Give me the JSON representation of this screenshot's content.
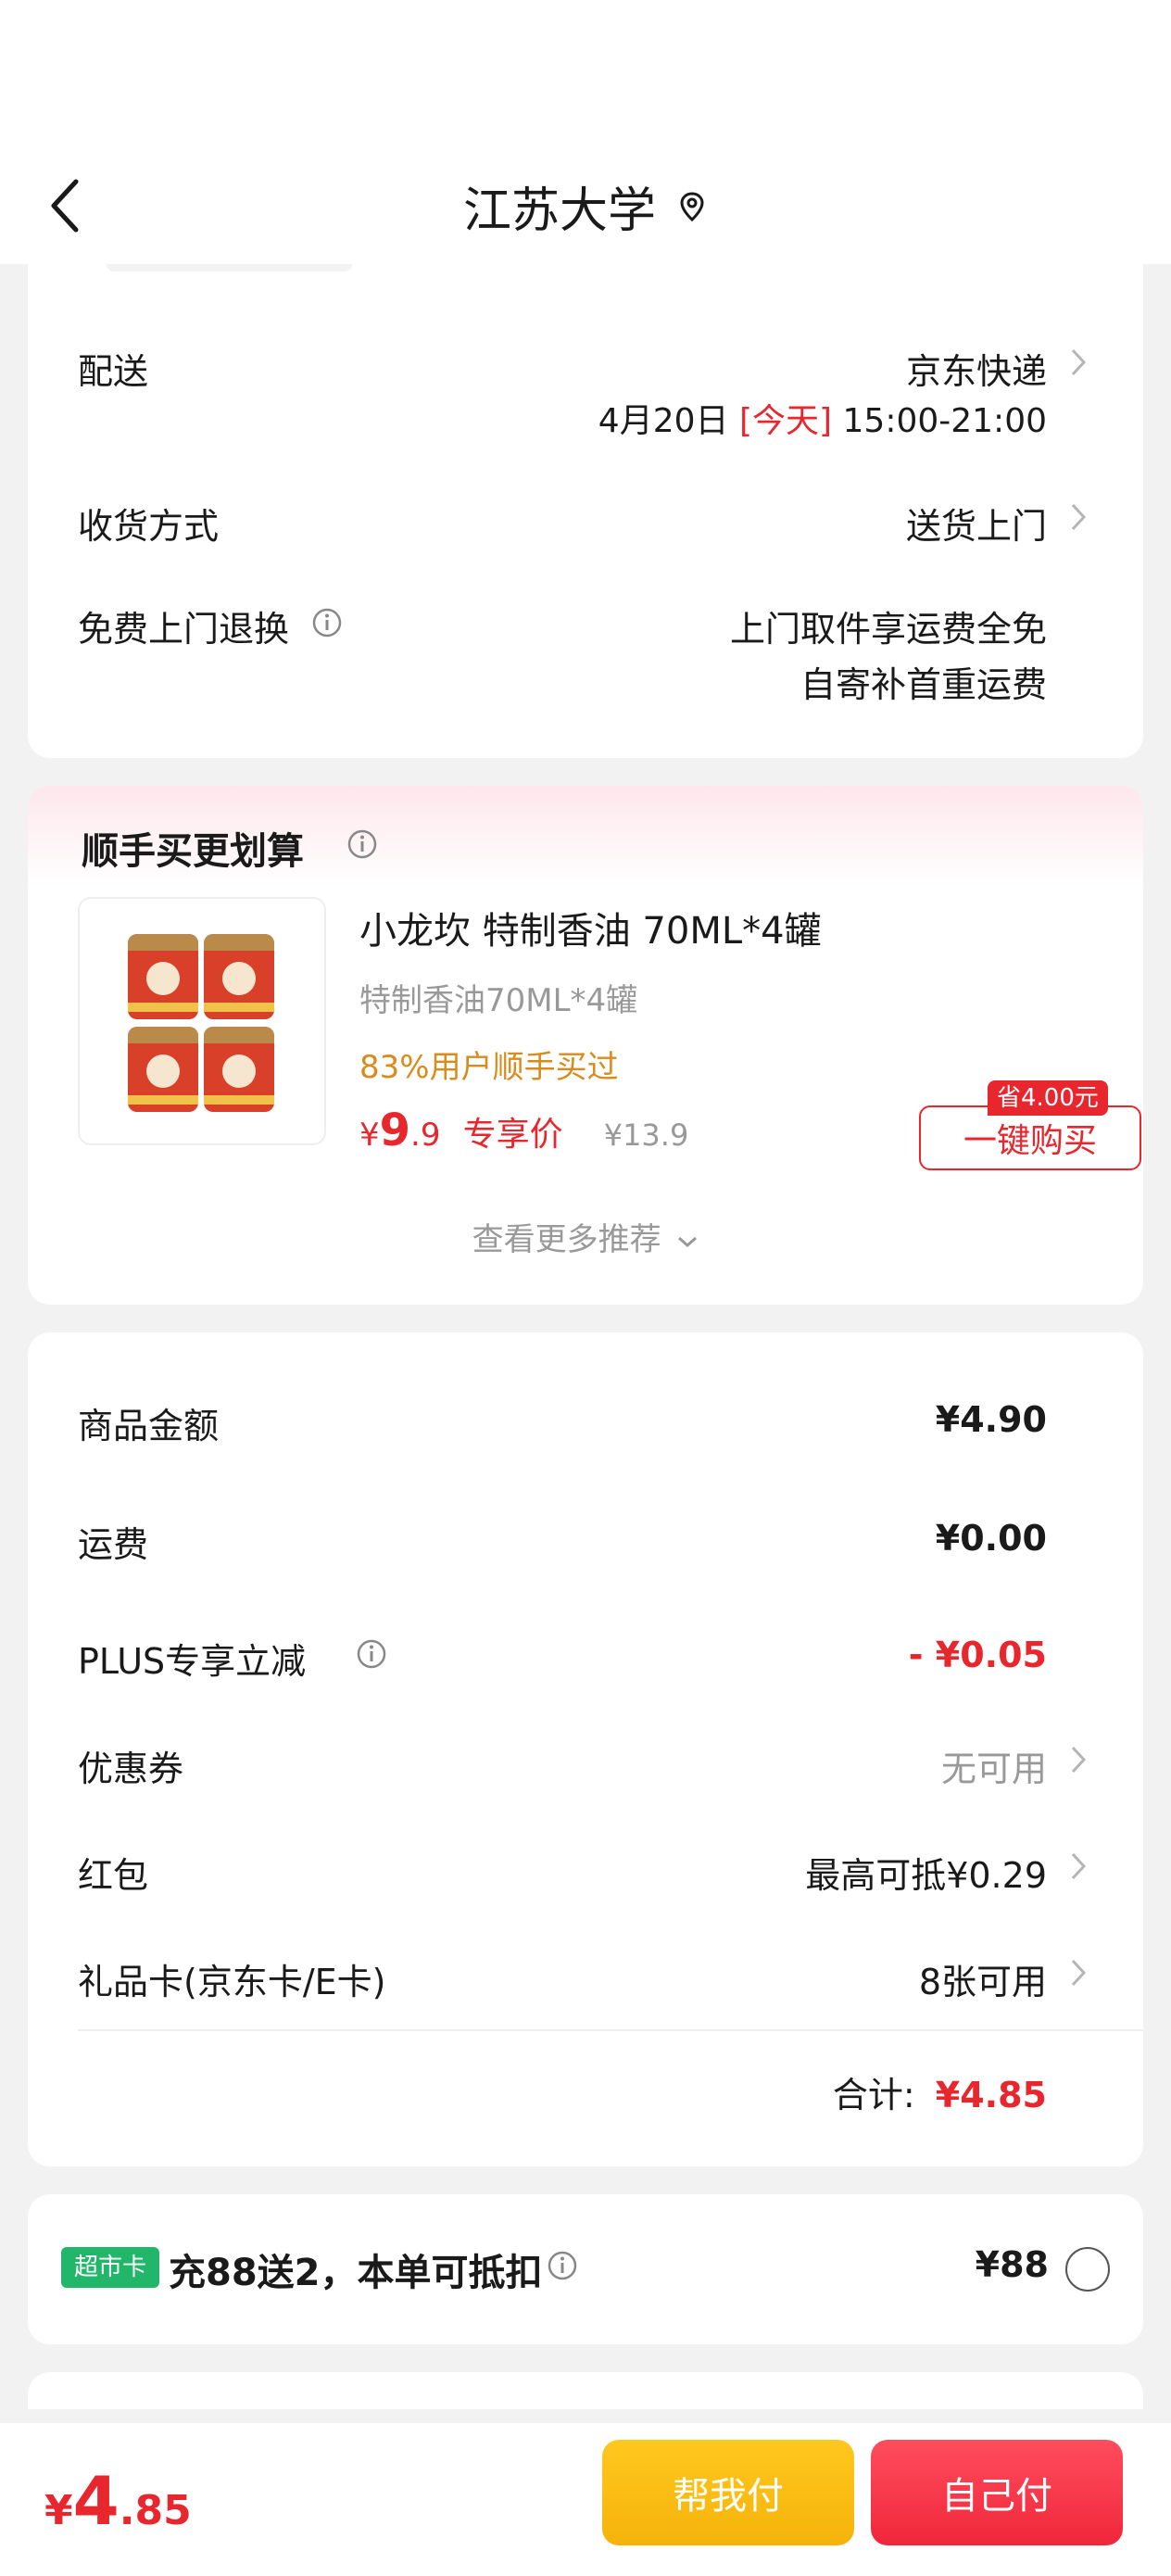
{
  "header": {
    "title": "江苏大学"
  },
  "delivery": {
    "label": "配送",
    "courier": "京东快递",
    "date": "4月20日",
    "today_tag": "[今天]",
    "time_range": "15:00-21:00",
    "method_label": "收货方式",
    "method_value": "送货上门",
    "return_label": "免费上门退换",
    "return_line1": "上门取件享运费全免",
    "return_line2": "自寄补首重运费"
  },
  "addon": {
    "title": "顺手买更划算",
    "product_name": "小龙坎 特制香油 70ML*4罐",
    "product_spec": "特制香油70ML*4罐",
    "purchase_stat": "83%用户顺手买过",
    "currency": "¥",
    "price_int": "9",
    "price_dec": ".9",
    "price_label": "专享价",
    "original_price": "¥13.9",
    "save_tag": "省4.00元",
    "buy_button": "一键购买",
    "more_link": "查看更多推荐"
  },
  "summary": {
    "goods_label": "商品金额",
    "goods_value": "¥4.90",
    "shipping_label": "运费",
    "shipping_value": "¥0.00",
    "plus_label": "PLUS专享立减",
    "plus_value": "- ¥0.05",
    "coupon_label": "优惠券",
    "coupon_value": "无可用",
    "redpacket_label": "红包",
    "redpacket_value": "最高可抵¥0.29",
    "giftcard_label": "礼品卡(京东卡/E卡)",
    "giftcard_value": "8张可用",
    "total_label": "合计:",
    "total_value": "¥4.85"
  },
  "supermarket": {
    "badge": "超市卡",
    "text": "充88送2，本单可抵扣",
    "price": "¥88"
  },
  "bottom": {
    "currency": "¥",
    "price_int": "4",
    "price_dec": ".85",
    "help_button": "帮我付",
    "self_button": "自己付"
  },
  "colors": {
    "accent_red": "#e8262d",
    "orange_text": "#d98c1a",
    "yellow_button": "#f9be14",
    "green_badge": "#21b66a"
  }
}
